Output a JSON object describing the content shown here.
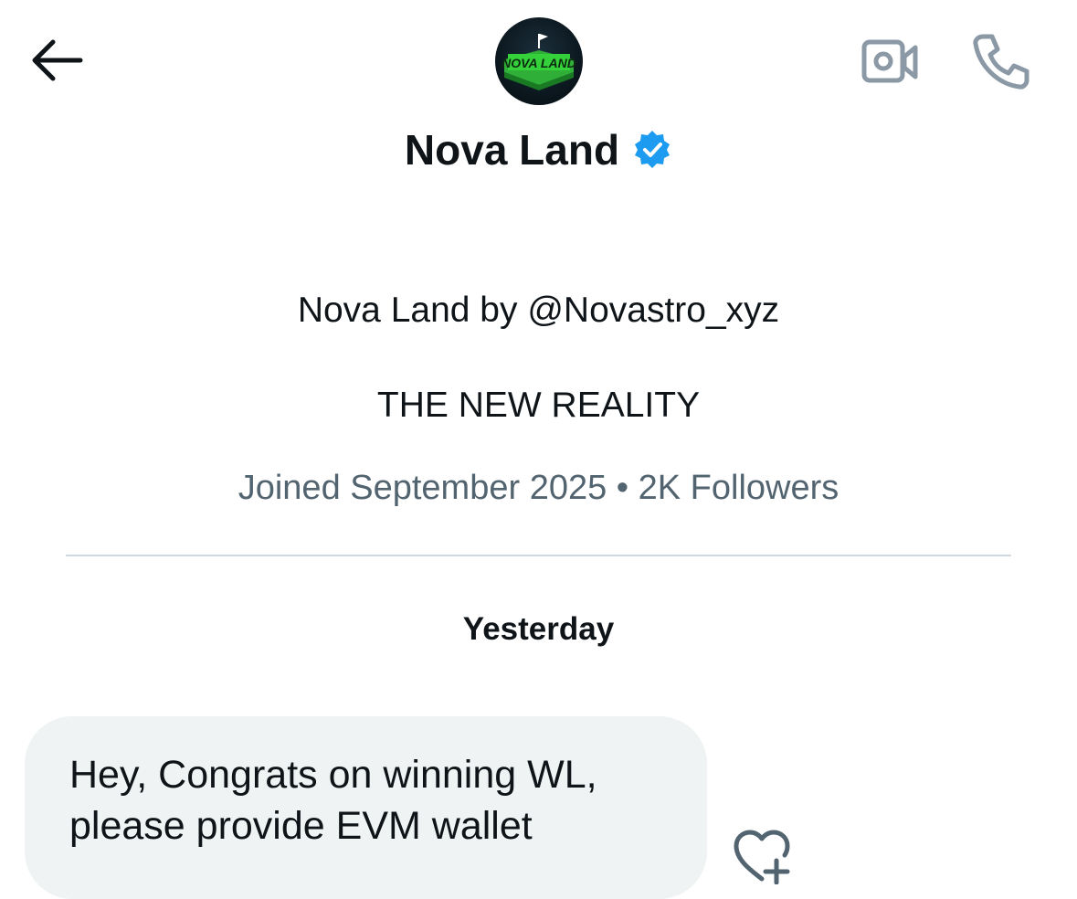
{
  "header": {
    "back_icon": "arrow-left-icon",
    "video_icon": "video-camera-icon",
    "phone_icon": "phone-icon",
    "avatar_logo_text": "NOVA LAND"
  },
  "profile": {
    "name": "Nova Land",
    "verified_icon": "verified-badge-icon",
    "bio_line_1": "Nova Land by @Novastro_xyz",
    "bio_line_2": "THE NEW REALITY",
    "meta": "Joined September 2025 • 2K Followers"
  },
  "conversation": {
    "date_label": "Yesterday",
    "message_text": "Hey, Congrats on winning WL,\nplease provide EVM wallet",
    "react_icon": "heart-plus-icon"
  },
  "colors": {
    "text": "#0f1419",
    "secondary_text": "#536471",
    "verified_blue": "#1d9bf0",
    "bubble_bg": "#eff3f4",
    "icon_gray": "#8b98a5",
    "logo_green": "#35d13b"
  }
}
